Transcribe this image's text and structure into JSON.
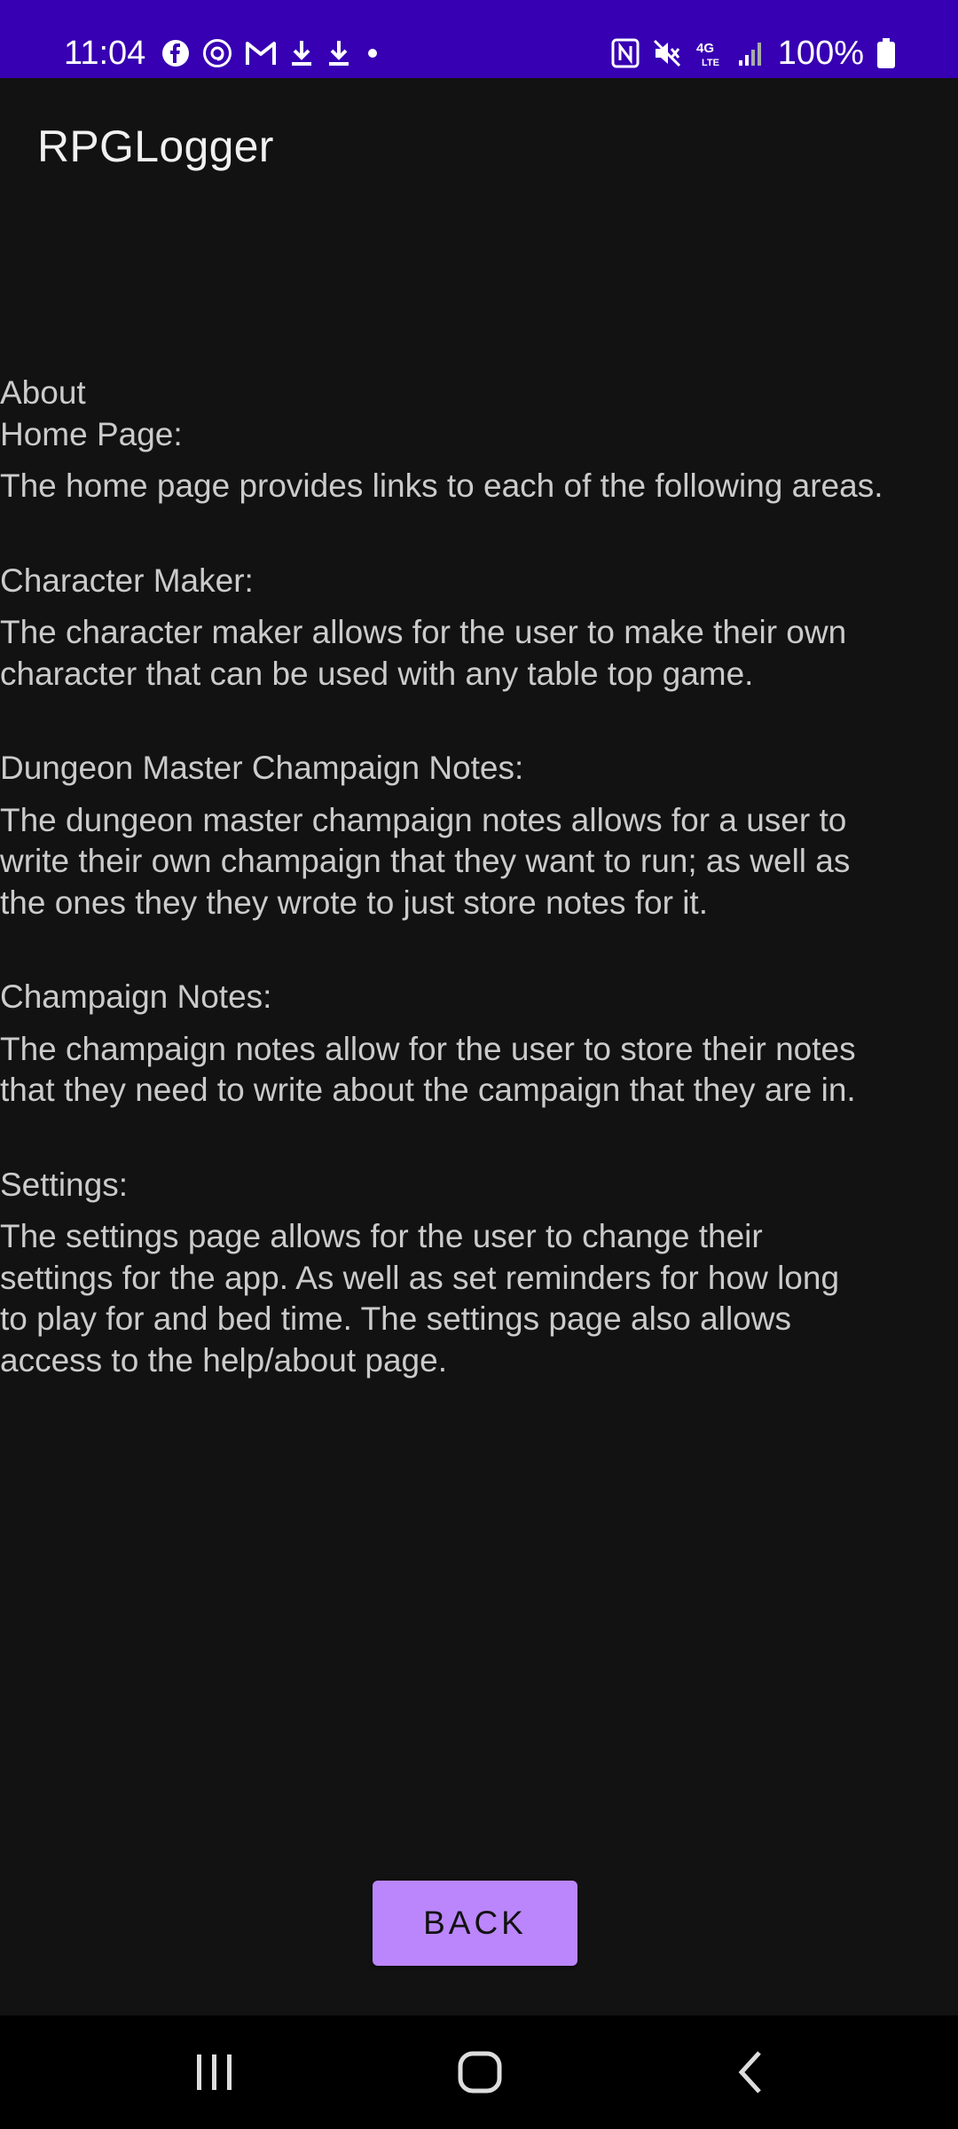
{
  "status_bar": {
    "time": "11:04",
    "left_icons": [
      "facebook-icon",
      "threads-icon",
      "gmail-icon",
      "download-icon",
      "download-icon",
      "dot-icon"
    ],
    "right_icons": [
      "nfc-icon",
      "mute-icon",
      "4g-lte-icon",
      "signal-icon"
    ],
    "battery": "100%",
    "color": "#3700b3"
  },
  "app_bar": {
    "title": "RPGLogger"
  },
  "content": {
    "title": "About",
    "sections": [
      {
        "heading": "Home Page:",
        "lines": [
          "The home page provides links to each of the following areas."
        ]
      },
      {
        "heading": "Character Maker:",
        "lines": [
          "The character maker allows for the user to make their own",
          "character that can be used with any table top game."
        ]
      },
      {
        "heading": "Dungeon Master Champaign Notes:",
        "lines": [
          "The dungeon master champaign notes allows for a user to",
          "write their own champaign that they want to run; as well as",
          "the ones they they wrote to just store notes for it."
        ]
      },
      {
        "heading": "Champaign Notes:",
        "lines": [
          "The champaign notes allow for the user to store their notes",
          "that they need to write about the campaign that they are in."
        ]
      },
      {
        "heading": "Settings:",
        "lines": [
          "The settings page allows for the user to change their",
          "settings for the app. As well as set reminders for how long",
          "to play for and bed time. The settings page also allows",
          "access to the help/about page."
        ]
      }
    ]
  },
  "back_button": {
    "label": "BACK",
    "color": "#bb86fc"
  },
  "nav_bar": {
    "buttons": [
      "recents-icon",
      "home-icon",
      "back-icon"
    ]
  }
}
